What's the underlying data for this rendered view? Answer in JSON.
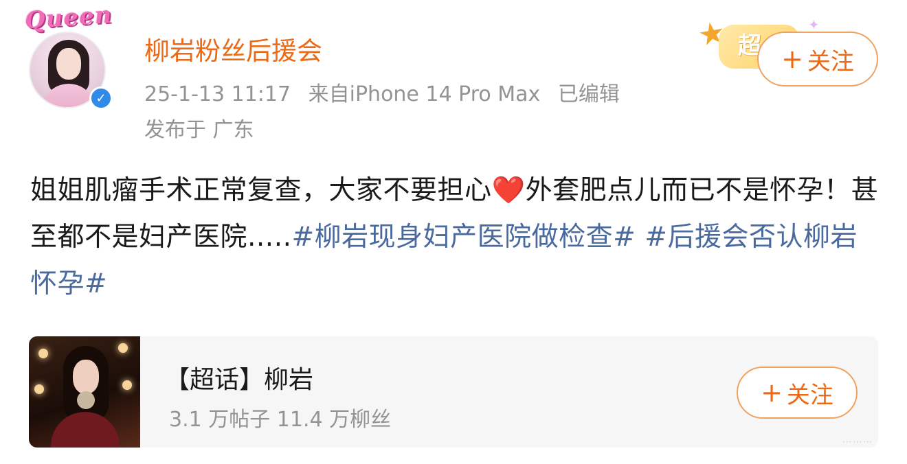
{
  "post": {
    "avatar_badge_text": "Queen",
    "username": "柳岩粉丝后援会",
    "verified_symbol": "✓",
    "timestamp": "25-1-13 11:17",
    "source": "来自iPhone 14 Pro Max",
    "edited": "已编辑",
    "location": "发布于 广东",
    "super_topic_badge": "超",
    "follow_plus": "+",
    "follow_label": "关注",
    "content": {
      "text_part1": "姐姐肌瘤手术正常复查，大家不要担心",
      "heart": "❤️",
      "text_part2": "外套肥点儿而已不是怀孕！甚至都不是妇产医院.....",
      "hashtag1": "#柳岩现身妇产医院做检查#",
      "hashtag2": "#后援会否认柳岩怀孕#"
    }
  },
  "card": {
    "title": "【超话】柳岩",
    "stats": "3.1 万帖子 11.4 万柳丝",
    "follow_plus": "+",
    "follow_label": "关注"
  },
  "icons": {
    "verified": "verified-check-icon",
    "star": "star-icon",
    "sparkle": "sparkle-icon"
  },
  "colors": {
    "username": "#ec6a15",
    "meta": "#939393",
    "hashtag": "#4a6a9f",
    "follow_border": "#f0a15d",
    "card_bg": "#f6f6f6",
    "verified": "#2f8ae8"
  }
}
